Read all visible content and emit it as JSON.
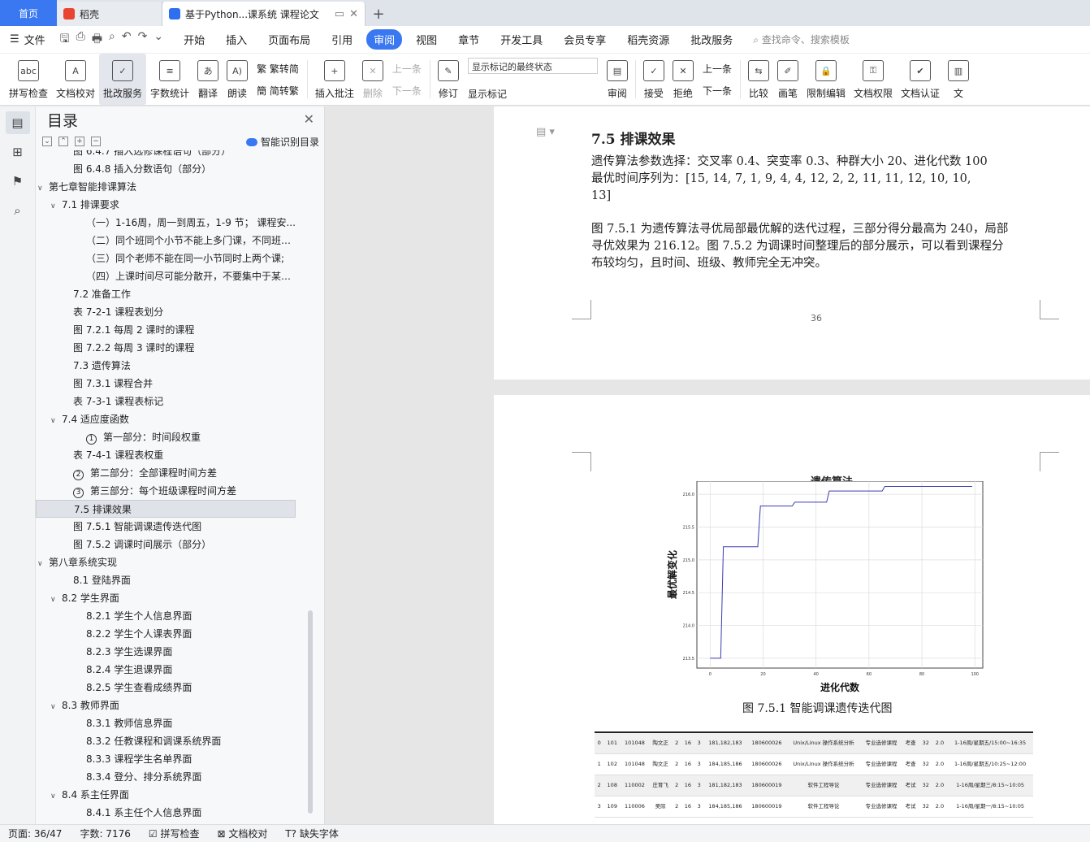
{
  "tabs": [
    {
      "label": "首页"
    },
    {
      "label": "稻壳"
    },
    {
      "label": "基于Python...课系统 课程论文"
    }
  ],
  "menu": {
    "file": "文件",
    "items": [
      "开始",
      "插入",
      "页面布局",
      "引用",
      "审阅",
      "视图",
      "章节",
      "开发工具",
      "会员专享",
      "稻壳资源",
      "批改服务"
    ],
    "active": "审阅",
    "search": "查找命令、搜索模板"
  },
  "ribbon": {
    "spell": "拼写检查",
    "proof": "文档校对",
    "correct": "批改服务",
    "wordcount": "字数统计",
    "translate": "翻译",
    "read": "朗读",
    "trad": "繁转简",
    "simp": "简转繁",
    "insert_comment": "插入批注",
    "delete": "删除",
    "prev": "上一条",
    "next": "下一条",
    "track": "修订",
    "markup_state": "显示标记的最终状态",
    "show_markup": "显示标记",
    "review": "审阅",
    "accept": "接受",
    "reject": "拒绝",
    "prev2": "上一条",
    "next2": "下一条",
    "compare": "比较",
    "pen": "画笔",
    "restrict": "限制编辑",
    "permission": "文档权限",
    "certify": "文档认证",
    "more": "文"
  },
  "toc": {
    "title": "目录",
    "smart": "智能识别目录",
    "items": [
      {
        "text": "图 6.4.7 插入选修课程语句（部分）",
        "level": 3
      },
      {
        "text": "图 6.4.8 插入分数语句（部分）",
        "level": 3
      },
      {
        "text": "第七章智能排课算法",
        "level": 1,
        "arrow": true
      },
      {
        "text": "7.1 排课要求",
        "level": 2,
        "arrow": true
      },
      {
        "text": "（一）1-16周，周一到周五，1-9 节； 课程安...",
        "level": 4
      },
      {
        "text": "（二）同个班同个小节不能上多门课，不同班同...",
        "level": 4
      },
      {
        "text": "（三）同个老师不能在同一小节同时上两个课;",
        "level": 4
      },
      {
        "text": "（四）上课时间尽可能分散开，不要集中于某一...",
        "level": 4
      },
      {
        "text": "7.2 准备工作",
        "level": 3
      },
      {
        "text": "表 7-2-1 课程表划分",
        "level": 3
      },
      {
        "text": "图 7.2.1 每周 2 课时的课程",
        "level": 3
      },
      {
        "text": "图 7.2.2 每周 3 课时的课程",
        "level": 3
      },
      {
        "text": "7.3 遗传算法",
        "level": 3
      },
      {
        "text": "图 7.3.1 课程合并",
        "level": 3
      },
      {
        "text": "表 7-3-1 课程表标记",
        "level": 3
      },
      {
        "text": "7.4 适应度函数",
        "level": 2,
        "arrow": true
      },
      {
        "text": "第一部分：时间段权重",
        "level": 4,
        "num": "1"
      },
      {
        "text": "表 7-4-1 课程表权重",
        "level": 3
      },
      {
        "text": "第二部分：全部课程时间方差",
        "level": 3,
        "num": "2"
      },
      {
        "text": "第三部分：每个班级课程时间方差",
        "level": 3,
        "num": "3"
      },
      {
        "text": "7.5 排课效果",
        "level": 3,
        "selected": true
      },
      {
        "text": "图 7.5.1 智能调课遗传迭代图",
        "level": 3
      },
      {
        "text": "图 7.5.2 调课时间展示（部分）",
        "level": 3
      },
      {
        "text": "第八章系统实现",
        "level": 1,
        "arrow": true
      },
      {
        "text": "8.1 登陆界面",
        "level": 3
      },
      {
        "text": "8.2 学生界面",
        "level": 2,
        "arrow": true
      },
      {
        "text": "8.2.1 学生个人信息界面",
        "level": 4
      },
      {
        "text": "8.2.2 学生个人课表界面",
        "level": 4
      },
      {
        "text": "8.2.3 学生选课界面",
        "level": 4
      },
      {
        "text": "8.2.4 学生退课界面",
        "level": 4
      },
      {
        "text": "8.2.5 学生查看成绩界面",
        "level": 4
      },
      {
        "text": "8.3 教师界面",
        "level": 2,
        "arrow": true
      },
      {
        "text": "8.3.1 教师信息界面",
        "level": 4
      },
      {
        "text": "8.3.2 任教课程和调课系统界面",
        "level": 4
      },
      {
        "text": "8.3.3 课程学生名单界面",
        "level": 4
      },
      {
        "text": "8.3.4 登分、排分系统界面",
        "level": 4
      },
      {
        "text": "8.4 系主任界面",
        "level": 2,
        "arrow": true
      },
      {
        "text": "8.4.1 系主任个人信息界面",
        "level": 4
      }
    ]
  },
  "doc": {
    "section_title": "7.5 排课效果",
    "param_line": "遗传算法参数选择：交叉率 0.4、突变率 0.3、种群大小 20、进化代数 100",
    "seq_line1": "最优时间序列为：[15, 14, 7, 1, 9, 4, 4, 12, 2, 2, 11, 11, 12, 10, 10,",
    "seq_line2": "13]",
    "para_line1": "图 7.5.1 为遗传算法寻优局部最优解的迭代过程，三部分得分最高为 240，局部",
    "para_line2": "寻优效果为 216.12。图 7.5.2 为调课时间整理后的部分展示，可以看到课程分",
    "para_line3": "布较均匀，且时间、班级、教师完全无冲突。",
    "page_number": "36",
    "figure_caption": "图 7.5.1 智能调课遗传迭代图"
  },
  "chart_data": {
    "type": "line",
    "title": "遗传算法",
    "xlabel": "进化代数",
    "ylabel": "最优解变化",
    "xlim": [
      -5,
      103
    ],
    "ylim": [
      213.35,
      216.2
    ],
    "xticks": [
      0,
      20,
      40,
      60,
      80,
      100
    ],
    "yticks": [
      213.5,
      214.0,
      214.5,
      215.0,
      215.5,
      216.0
    ],
    "ytick_labels": [
      "213.5",
      "214.0",
      "214.5",
      "215.0",
      "215.5",
      "216.0"
    ],
    "grid": true,
    "series": [
      {
        "x": [
          0,
          4,
          5,
          18,
          19,
          31,
          32,
          44,
          45,
          65,
          66,
          99
        ],
        "y": [
          213.5,
          213.5,
          215.2,
          215.2,
          215.82,
          215.82,
          215.88,
          215.88,
          216.05,
          216.05,
          216.12,
          216.12
        ],
        "color": "#3b3bb3"
      }
    ]
  },
  "table": {
    "rows": [
      [
        "0",
        "101",
        "101048",
        "陶文正",
        "2",
        "16",
        "3",
        "181,182,183",
        "180600026",
        "Unix/Linux 操作系统分析",
        "专业选修课程",
        "考查",
        "32",
        "2.0",
        "1-16周/星期五/15:00~16:35"
      ],
      [
        "1",
        "102",
        "101048",
        "陶文正",
        "2",
        "16",
        "3",
        "184,185,186",
        "180600026",
        "Unix/Linux 操作系统分析",
        "专业选修课程",
        "考查",
        "32",
        "2.0",
        "1-16周/星期五/10:25~12:00"
      ],
      [
        "2",
        "108",
        "110002",
        "庄育飞",
        "2",
        "16",
        "3",
        "181,182,183",
        "180600019",
        "软件工程导论",
        "专业选修课程",
        "考试",
        "32",
        "2.0",
        "1-16周/星期三/8:15~10:05"
      ],
      [
        "3",
        "109",
        "110006",
        "吴际",
        "2",
        "16",
        "3",
        "184,185,186",
        "180600019",
        "软件工程导论",
        "专业选修课程",
        "考试",
        "32",
        "2.0",
        "1-16周/星期一/8:15~10:05"
      ]
    ]
  },
  "status": {
    "page": "页面: 36/47",
    "words": "字数: 7176",
    "spell": "拼写检查",
    "proof": "文档校对",
    "missing_font": "缺失字体"
  }
}
